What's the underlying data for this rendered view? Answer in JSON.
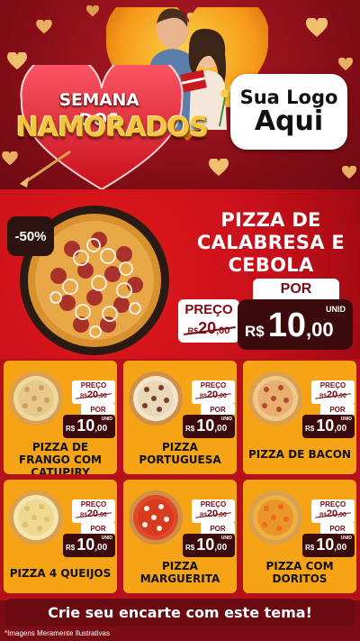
{
  "header": {
    "title_line1": "SEMANA DOS",
    "title_line2": "NAMORADOS",
    "logo_line1": "Sua Logo",
    "logo_line2": "Aqui"
  },
  "hero": {
    "discount": "-50%",
    "title": "PIZZA DE CALABRESA E CEBOLA",
    "por_label": "POR",
    "preco_label": "PREÇO",
    "old_currency": "R$",
    "old_int": "20",
    "old_dec": ",00",
    "unid_label": "UNID",
    "new_currency": "R$",
    "new_int": "10",
    "new_dec": ",00"
  },
  "products": [
    {
      "name": "PIZZA DE FRANGO COM CATUPIRY",
      "preco_label": "PREÇO",
      "old_currency": "R$",
      "old_int": "20",
      "old_dec": ",00",
      "por_label": "POR",
      "unid_label": "UNID",
      "currency": "R$",
      "int": "10",
      "dec": ",00"
    },
    {
      "name": "PIZZA PORTUGUESA",
      "preco_label": "PREÇO",
      "old_currency": "R$",
      "old_int": "20",
      "old_dec": ",00",
      "por_label": "POR",
      "unid_label": "UNID",
      "currency": "R$",
      "int": "10",
      "dec": ",00"
    },
    {
      "name": "PIZZA DE BACON",
      "preco_label": "PREÇO",
      "old_currency": "R$",
      "old_int": "20",
      "old_dec": ",00",
      "por_label": "POR",
      "unid_label": "UNID",
      "currency": "R$",
      "int": "10",
      "dec": ",00"
    },
    {
      "name": "PIZZA 4 QUEIJOS",
      "preco_label": "PREÇO",
      "old_currency": "R$",
      "old_int": "20",
      "old_dec": ",00",
      "por_label": "POR",
      "unid_label": "UNID",
      "currency": "R$",
      "int": "10",
      "dec": ",00"
    },
    {
      "name": "PIZZA MARGUERITA",
      "preco_label": "PREÇO",
      "old_currency": "R$",
      "old_int": "20",
      "old_dec": ",00",
      "por_label": "POR",
      "unid_label": "UNID",
      "currency": "R$",
      "int": "10",
      "dec": ",00"
    },
    {
      "name": "PIZZA COM DORITOS",
      "preco_label": "PREÇO",
      "old_currency": "R$",
      "old_int": "20",
      "old_dec": ",00",
      "por_label": "POR",
      "unid_label": "UNID",
      "currency": "R$",
      "int": "10",
      "dec": ",00"
    }
  ],
  "footer": {
    "cta": "Crie seu encarte com este tema!",
    "note": "*Imagens Meramente Ilustrativas"
  },
  "colors": {
    "background": "#7a0b14",
    "hero_red": "#c8101a",
    "card_orange": "#f6a416",
    "price_dark": "#3b0a0c",
    "title_gold": "#f5c542"
  },
  "icons": [
    "heart-icon",
    "pizza-image",
    "couple-photo"
  ]
}
